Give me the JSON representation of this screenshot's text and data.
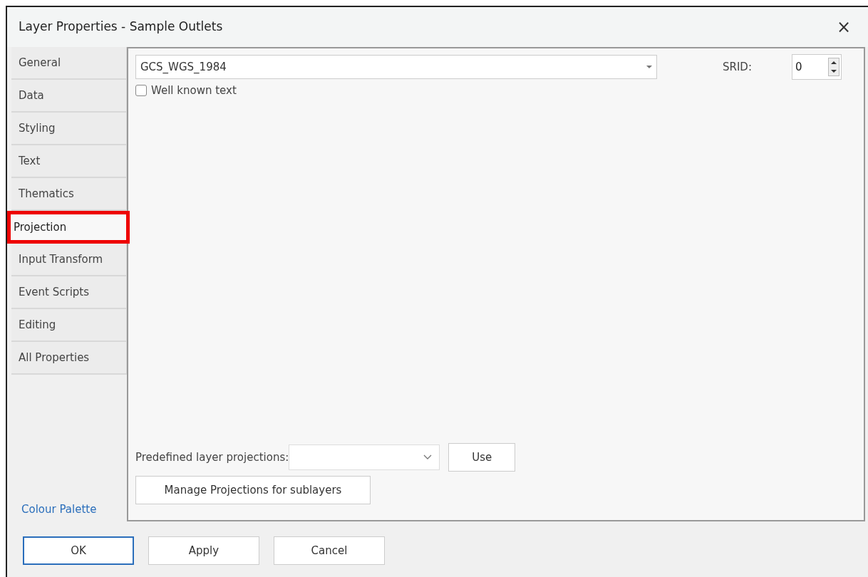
{
  "window": {
    "title": "Layer Properties - Sample Outlets",
    "close": "×"
  },
  "tabs": [
    {
      "label": "General",
      "selected": false
    },
    {
      "label": "Data",
      "selected": false
    },
    {
      "label": "Styling",
      "selected": false
    },
    {
      "label": "Text",
      "selected": false
    },
    {
      "label": "Thematics",
      "selected": false
    },
    {
      "label": "Projection",
      "selected": true
    },
    {
      "label": "Input Transform",
      "selected": false
    },
    {
      "label": "Event Scripts",
      "selected": false
    },
    {
      "label": "Editing",
      "selected": false
    },
    {
      "label": "All Properties",
      "selected": false
    }
  ],
  "colour_palette_link": "Colour Palette",
  "projection": {
    "value": "GCS_WGS_1984",
    "srid_label": "SRID:",
    "srid_value": "0",
    "wkt": {
      "label": "Well known text",
      "checked": false
    }
  },
  "predefined": {
    "label": "Predefined layer projections:",
    "use_button": "Use"
  },
  "manage_button": "Manage Projections for sublayers",
  "buttons": [
    {
      "label": "OK",
      "default": true
    },
    {
      "label": "Apply",
      "default": false
    },
    {
      "label": "Cancel",
      "default": false
    }
  ]
}
